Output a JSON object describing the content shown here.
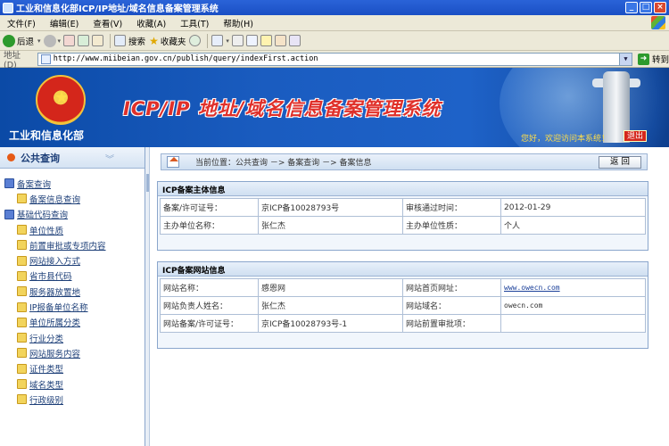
{
  "window": {
    "title": "工业和信息化部ICP/IP地址/域名信息备案管理系统",
    "min": "_",
    "max": "□",
    "close": "×"
  },
  "menu": [
    "文件(F)",
    "编辑(E)",
    "查看(V)",
    "收藏(A)",
    "工具(T)",
    "帮助(H)"
  ],
  "toolbar": {
    "back_label": "后退",
    "search_label": "搜索",
    "favorites_label": "收藏夹"
  },
  "address": {
    "label": "地址(D)",
    "url": "http://www.miibeian.gov.cn/publish/query/indexFirst.action",
    "go_label": "转到"
  },
  "banner": {
    "ministry": "工业和信息化部",
    "system_title": "ICP/IP 地址/域名信息备案管理系统",
    "welcome": "您好，欢迎访问本系统！",
    "exit_label": "退出"
  },
  "sidebar": {
    "title": "公共查询",
    "items": [
      {
        "label": "备案查询",
        "level": "root"
      },
      {
        "label": "备案信息查询",
        "level": "child"
      },
      {
        "label": "基础代码查询",
        "level": "root"
      },
      {
        "label": "单位性质",
        "level": "child"
      },
      {
        "label": "前置审批或专项内容",
        "level": "child"
      },
      {
        "label": "网站接入方式",
        "level": "child"
      },
      {
        "label": "省市县代码",
        "level": "child"
      },
      {
        "label": "服务器放置地",
        "level": "child"
      },
      {
        "label": "IP报备单位名称",
        "level": "child"
      },
      {
        "label": "单位所属分类",
        "level": "child"
      },
      {
        "label": "行业分类",
        "level": "child"
      },
      {
        "label": "网站服务内容",
        "level": "child"
      },
      {
        "label": "证件类型",
        "level": "child"
      },
      {
        "label": "域名类型",
        "level": "child"
      },
      {
        "label": "行政级别",
        "level": "child"
      }
    ]
  },
  "breadcrumb": {
    "text": "当前位置：公共查询  －>  备案查询  －>  备案信息",
    "back_label": "返  回"
  },
  "subject_panel": {
    "title": "ICP备案主体信息",
    "rows": [
      [
        "备案/许可证号：",
        "京ICP备10028793号",
        "审核通过时间：",
        "2012-01-29"
      ],
      [
        "主办单位名称：",
        "张仁杰",
        "主办单位性质：",
        "个人"
      ]
    ]
  },
  "site_panel": {
    "title": "ICP备案网站信息",
    "rows": [
      [
        "网站名称：",
        "感恩网",
        "网站首页网址：",
        "www.owecn.com"
      ],
      [
        "网站负责人姓名：",
        "张仁杰",
        "网站域名：",
        "owecn.com"
      ],
      [
        "网站备案/许可证号：",
        "京ICP备10028793号-1",
        "网站前置审批项：",
        ""
      ]
    ]
  }
}
